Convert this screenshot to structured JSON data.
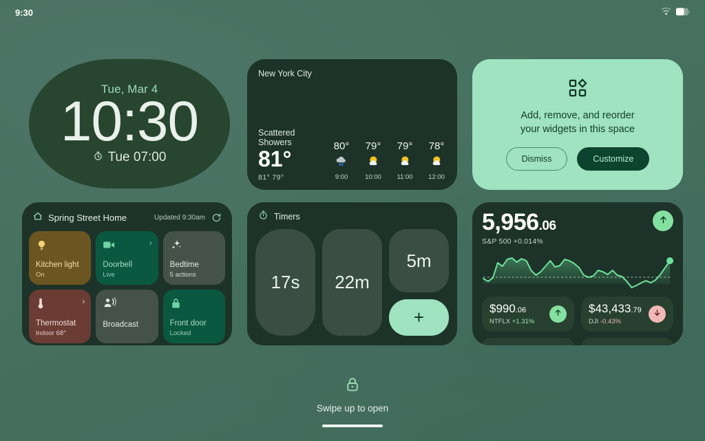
{
  "status_bar": {
    "time": "9:30",
    "wifi_icon": "wifi-icon",
    "battery_icon": "battery-icon"
  },
  "clock_widget": {
    "date": "Tue, Mar 4",
    "time": "10:30",
    "alarm_icon": "alarm-clock-icon",
    "alarm": "Tue 07:00"
  },
  "weather_widget": {
    "city": "New York City",
    "condition": "Scattered Showers",
    "temperature": "81°",
    "high_low": "81°  79°",
    "hourly": [
      {
        "temp": "80°",
        "icon": "rain-cloud-icon",
        "time": "9:00"
      },
      {
        "temp": "79°",
        "icon": "sun-behind-cloud-icon",
        "time": "10:00"
      },
      {
        "temp": "79°",
        "icon": "sun-behind-cloud-icon",
        "time": "11:00"
      },
      {
        "temp": "78°",
        "icon": "sun-behind-cloud-icon",
        "time": "12:00"
      }
    ]
  },
  "suggestion_widget": {
    "icon": "widgets-grid-icon",
    "message_line1": "Add, remove, and reorder",
    "message_line2": "your widgets in this space",
    "dismiss_label": "Dismiss",
    "customize_label": "Customize",
    "accent_bg": "#9fe3c0",
    "primary_btn_bg": "#0d4430"
  },
  "home_widget": {
    "home_icon": "house-icon",
    "title": "Spring Street Home",
    "updated": "Updated 9:30am",
    "refresh_icon": "refresh-icon",
    "tiles": [
      {
        "icon": "lightbulb-icon",
        "name": "Kitchen light",
        "sub": "On",
        "chevron": "",
        "color": "#6b5520"
      },
      {
        "icon": "video-camera-icon",
        "name": "Doorbell",
        "sub": "Live",
        "chevron": "›",
        "color": "#0b5840"
      },
      {
        "icon": "sparkles-icon",
        "name": "Bedtime",
        "sub": "5 actions",
        "chevron": "",
        "color": "#455249"
      },
      {
        "icon": "thermometer-icon",
        "name": "Thermostat",
        "sub": "Indoor 68°",
        "chevron": "›",
        "color": "#6a3c34"
      },
      {
        "icon": "broadcast-icon",
        "name": "Broadcast",
        "sub": "",
        "chevron": "",
        "color": "#455249"
      },
      {
        "icon": "lock-icon",
        "name": "Front door",
        "sub": "Locked",
        "chevron": "",
        "color": "#0b5840"
      }
    ]
  },
  "timers_widget": {
    "icon": "stopwatch-icon",
    "title": "Timers",
    "timers": [
      "17s",
      "22m",
      "5m"
    ],
    "add_label": "+"
  },
  "stocks_widget": {
    "index_price_main": "5,956",
    "index_price_dec": ".06",
    "index_label": "S&P 500 +0.014%",
    "index_direction_icon": "arrow-up-icon",
    "tickers": [
      {
        "price_main": "$990",
        "price_dec": ".06",
        "symbol": "NTFLX",
        "change": "+1.31%",
        "direction": "up",
        "direction_icon": "arrow-up-icon"
      },
      {
        "price_main": "$43,433",
        "price_dec": ".79",
        "symbol": "DJI",
        "change": "-0.43%",
        "direction": "down",
        "direction_icon": "arrow-down-icon"
      }
    ]
  },
  "chart_data": {
    "type": "area",
    "title": "S&P 500 intraday",
    "xlabel": "",
    "ylabel": "",
    "grid": false,
    "legend": null,
    "series": [
      {
        "name": "S&P 500",
        "color": "#6ee29a",
        "values": [
          18,
          40,
          7,
          6,
          28,
          46,
          50,
          42,
          47,
          44,
          28,
          20,
          25,
          35,
          44,
          34,
          36,
          46,
          44,
          40,
          29,
          20,
          17,
          21,
          30,
          26,
          22,
          30,
          22,
          20,
          12,
          2,
          5,
          10,
          13,
          10,
          14,
          24,
          35,
          44,
          52
        ]
      }
    ],
    "baseline": 20,
    "baseline_style": "dashed",
    "last_point_marker": true,
    "ylim": [
      0,
      60
    ]
  },
  "footer": {
    "lock_icon": "lock-icon",
    "swipe_text": "Swipe up to open"
  }
}
